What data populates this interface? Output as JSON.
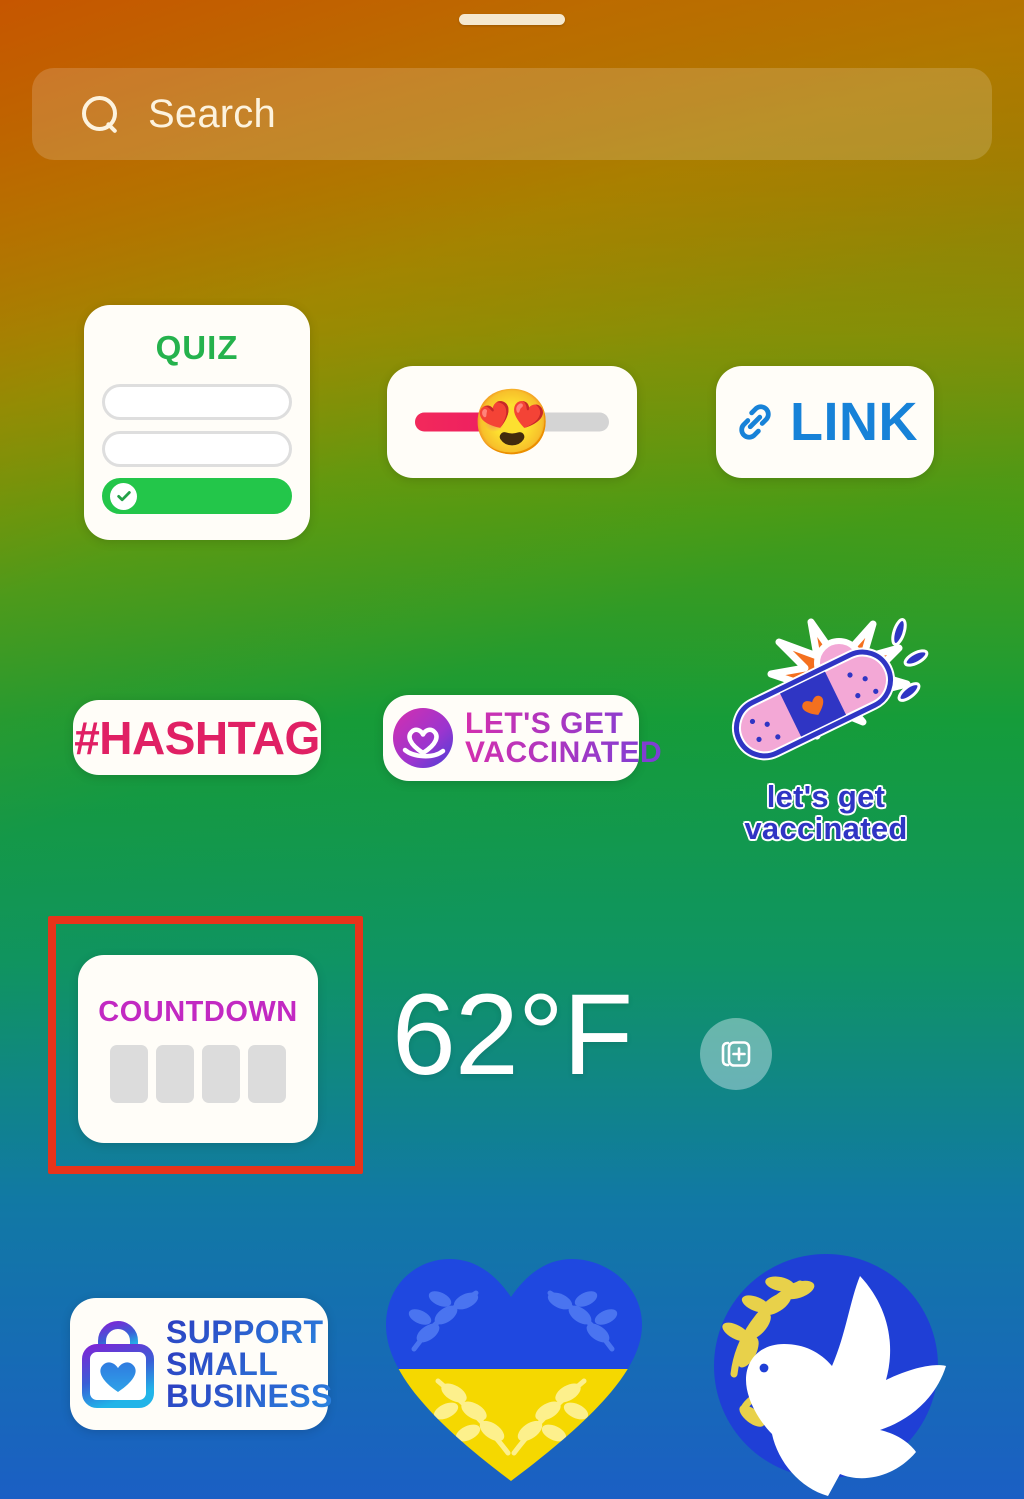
{
  "app": {
    "name": "Instagram Stories Sticker Tray",
    "drag_handle_label": "drag-handle"
  },
  "search": {
    "placeholder": "Search",
    "icon": "search-icon",
    "value": ""
  },
  "annotation": {
    "target": "Countdown sticker",
    "color": "#e8331a",
    "shape": "rectangle"
  },
  "stickers": [
    {
      "id": "quiz",
      "name": "Quiz sticker",
      "title": "QUIZ",
      "title_color": "#25b24d",
      "options": [
        "",
        "",
        ""
      ],
      "correct_option_index": 2,
      "correct_color": "#23c64a",
      "check_icon": "check-circle-icon"
    },
    {
      "id": "emoji-slider",
      "name": "Emoji slider sticker",
      "emoji": "😍",
      "emoji_name": "heart-eyes-emoji",
      "fill_percent": 50,
      "fill_color": "#ec1c63",
      "track_color": "#d4d4d4"
    },
    {
      "id": "link",
      "name": "Link sticker",
      "label": "LINK",
      "color": "#1782d8",
      "icon": "chain-link-icon"
    },
    {
      "id": "hashtag",
      "name": "Hashtag sticker",
      "label": "#HASHTAG",
      "color": "#e02064"
    },
    {
      "id": "vaccinated-badge",
      "name": "Let's get vaccinated badge sticker",
      "line1": "LET'S GET",
      "line2": "VACCINATED",
      "icon": "heart-ribbon-icon",
      "gradient_from": "#d52fae",
      "gradient_to": "#7a3fd6"
    },
    {
      "id": "flower-bandage",
      "name": "Let's get vaccinated flower bandage sticker",
      "caption_line1": "let's get",
      "caption_line2": "vaccinated",
      "caption_color": "#2f35c4",
      "icon": "bandage-flower-icon"
    },
    {
      "id": "countdown",
      "name": "Countdown sticker",
      "title": "COUNTDOWN",
      "title_color": "#c229c2",
      "digit_slots": 4,
      "slot_color": "#dcdcdc"
    },
    {
      "id": "temperature",
      "name": "Temperature sticker",
      "value": "62°F",
      "color": "#ffffff"
    },
    {
      "id": "add-sticker",
      "name": "Add sticker button",
      "icon": "add-stack-icon"
    },
    {
      "id": "support-small-business",
      "name": "Support small business sticker",
      "line1": "SUPPORT",
      "line2": "SMALL",
      "line3": "BUSINESS",
      "icon": "shopping-bag-heart-icon",
      "gradient_from": "#2d3bbf",
      "gradient_to": "#2a87e0"
    },
    {
      "id": "ukraine-heart",
      "name": "Ukraine flag heart sticker",
      "icon": "ukraine-heart-icon",
      "top_color": "#1f48e0",
      "bottom_color": "#f5d800"
    },
    {
      "id": "peace-dove",
      "name": "Peace dove sticker",
      "icon": "peace-dove-icon",
      "circle_color": "#1f3fd6",
      "dove_color": "#ffffff",
      "branch_color": "#e8d14a"
    }
  ]
}
